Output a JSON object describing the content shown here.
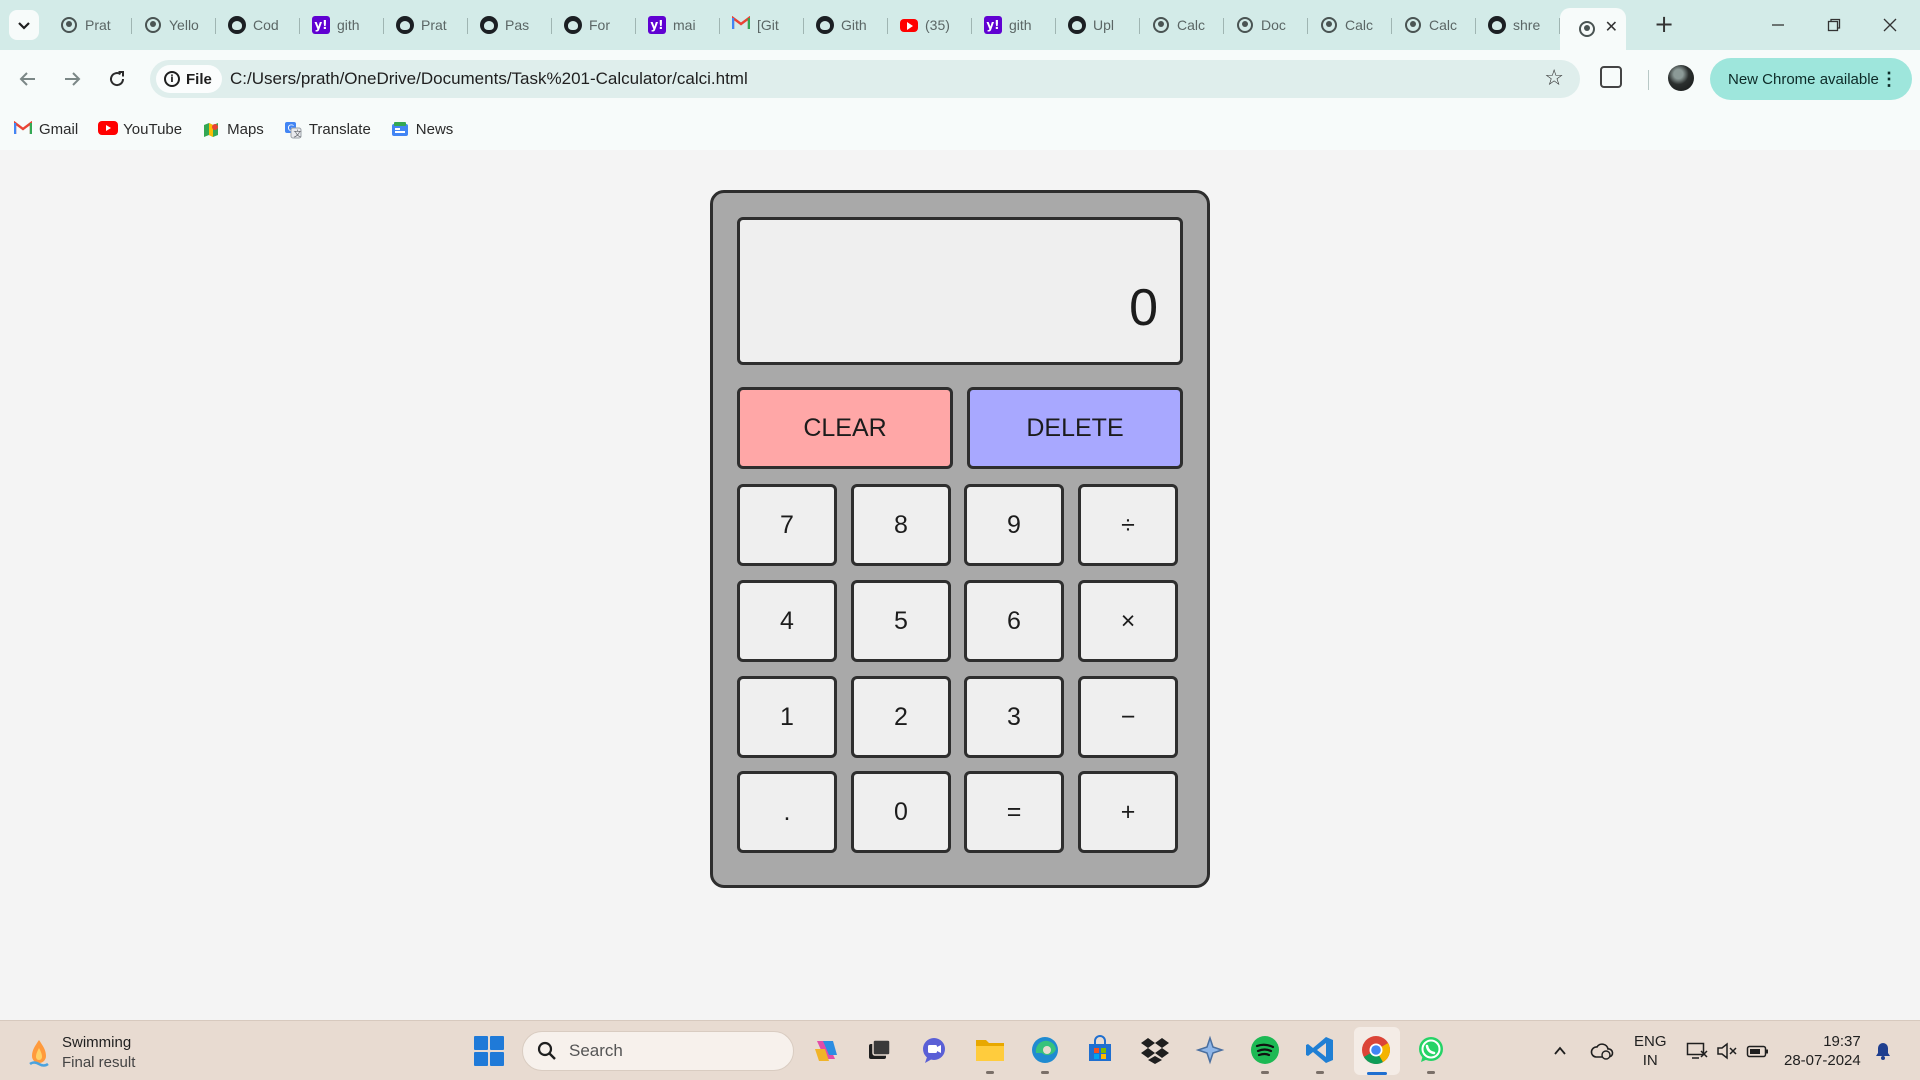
{
  "browser": {
    "tabs": [
      {
        "icon": "globe",
        "title": "Prat"
      },
      {
        "icon": "globe",
        "title": "Yello"
      },
      {
        "icon": "github",
        "title": "Cod"
      },
      {
        "icon": "yahoo",
        "title": "gith"
      },
      {
        "icon": "github",
        "title": "Prat"
      },
      {
        "icon": "github",
        "title": "Pas"
      },
      {
        "icon": "github",
        "title": "For"
      },
      {
        "icon": "yahoo",
        "title": "mai"
      },
      {
        "icon": "gmail",
        "title": "[Git"
      },
      {
        "icon": "github",
        "title": "Gith"
      },
      {
        "icon": "youtube",
        "title": "(35)"
      },
      {
        "icon": "yahoo",
        "title": "gith"
      },
      {
        "icon": "github",
        "title": "Upl"
      },
      {
        "icon": "globe",
        "title": "Calc"
      },
      {
        "icon": "globe",
        "title": "Doc"
      },
      {
        "icon": "globe",
        "title": "Calc"
      },
      {
        "icon": "globe",
        "title": "Calc"
      },
      {
        "icon": "github",
        "title": "shre"
      }
    ],
    "active_tab": {
      "icon": "globe",
      "close": "✕"
    },
    "new_tab": "+",
    "omnibox": {
      "chip_label": "File",
      "url": "C:/Users/prath/OneDrive/Documents/Task%201-Calculator/calci.html"
    },
    "update_label": "New Chrome available",
    "bookmarks": [
      {
        "icon": "gmail-icon",
        "label": "Gmail"
      },
      {
        "icon": "youtube-icon",
        "label": "YouTube"
      },
      {
        "icon": "maps-icon",
        "label": "Maps"
      },
      {
        "icon": "translate-icon",
        "label": "Translate"
      },
      {
        "icon": "news-icon",
        "label": "News"
      }
    ]
  },
  "calculator": {
    "display": "0",
    "clear_label": "CLEAR",
    "delete_label": "DELETE",
    "keys": [
      "7",
      "8",
      "9",
      "÷",
      "4",
      "5",
      "6",
      "×",
      "1",
      "2",
      "3",
      "−",
      ".",
      "0",
      "=",
      "+"
    ],
    "colors": {
      "body": "#a9a9a9",
      "clear": "#ffa7a7",
      "delete": "#a8a8ff",
      "key": "#efefef"
    }
  },
  "taskbar": {
    "weather": {
      "title": "Swimming",
      "subtitle": "Final result"
    },
    "search_placeholder": "Search",
    "language": {
      "line1": "ENG",
      "line2": "IN"
    },
    "time": "19:37",
    "date": "28-07-2024"
  }
}
